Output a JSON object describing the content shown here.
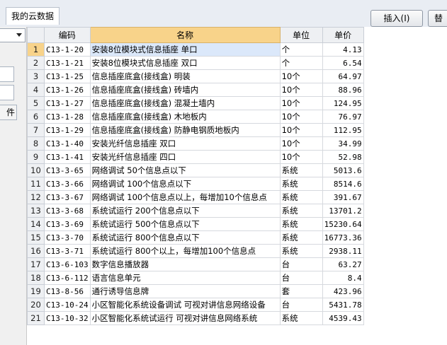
{
  "tabs": {
    "mycloud": "我的云数据"
  },
  "toolbar": {
    "insert_label": "插入(I)",
    "replace_label": "替"
  },
  "left": {
    "file_label": "件"
  },
  "grid": {
    "columns": [
      "编码",
      "名称",
      "单位",
      "单价"
    ],
    "rows": [
      {
        "n": "1",
        "code": "C13-1-20",
        "name": "安装8位模块式信息插座 单口",
        "unit": "个",
        "price": "4.13"
      },
      {
        "n": "2",
        "code": "C13-1-21",
        "name": "安装8位模块式信息插座 双口",
        "unit": "个",
        "price": "6.54"
      },
      {
        "n": "3",
        "code": "C13-1-25",
        "name": "信息插座底盒(接线盒) 明装",
        "unit": "10个",
        "price": "64.97"
      },
      {
        "n": "4",
        "code": "C13-1-26",
        "name": "信息插座底盒(接线盒) 砖墙内",
        "unit": "10个",
        "price": "88.96"
      },
      {
        "n": "5",
        "code": "C13-1-27",
        "name": "信息插座底盒(接线盒) 混凝土墙内",
        "unit": "10个",
        "price": "124.95"
      },
      {
        "n": "6",
        "code": "C13-1-28",
        "name": "信息插座底盒(接线盒) 木地板内",
        "unit": "10个",
        "price": "76.97"
      },
      {
        "n": "7",
        "code": "C13-1-29",
        "name": "信息插座底盒(接线盒) 防静电钢质地板内",
        "unit": "10个",
        "price": "112.95"
      },
      {
        "n": "8",
        "code": "C13-1-40",
        "name": "安装光纤信息插座 双口",
        "unit": "10个",
        "price": "34.99"
      },
      {
        "n": "9",
        "code": "C13-1-41",
        "name": "安装光纤信息插座 四口",
        "unit": "10个",
        "price": "52.98"
      },
      {
        "n": "10",
        "code": "C13-3-65",
        "name": "网络调试 50个信息点以下",
        "unit": "系统",
        "price": "5013.6"
      },
      {
        "n": "11",
        "code": "C13-3-66",
        "name": "网络调试 100个信息点以下",
        "unit": "系统",
        "price": "8514.6"
      },
      {
        "n": "12",
        "code": "C13-3-67",
        "name": "网络调试 100个信息点以上，每增加10个信息点",
        "unit": "系统",
        "price": "391.67"
      },
      {
        "n": "13",
        "code": "C13-3-68",
        "name": "系统试运行 200个信息点以下",
        "unit": "系统",
        "price": "13701.2"
      },
      {
        "n": "14",
        "code": "C13-3-69",
        "name": "系统试运行 500个信息点以下",
        "unit": "系统",
        "price": "15230.64"
      },
      {
        "n": "15",
        "code": "C13-3-70",
        "name": "系统试运行 800个信息点以下",
        "unit": "系统",
        "price": "16773.36"
      },
      {
        "n": "16",
        "code": "C13-3-71",
        "name": "系统试运行 800个以上，每增加100个信息点",
        "unit": "系统",
        "price": "2938.11"
      },
      {
        "n": "17",
        "code": "C13-6-103",
        "name": "数字信息播放器",
        "unit": "台",
        "price": "63.27"
      },
      {
        "n": "18",
        "code": "C13-6-112",
        "name": "语言信息单元",
        "unit": "台",
        "price": "8.4"
      },
      {
        "n": "19",
        "code": "C13-8-56",
        "name": "通行诱导信息牌",
        "unit": "套",
        "price": "423.96"
      },
      {
        "n": "20",
        "code": "C13-10-24",
        "name": "小区智能化系统设备调试 可视对讲信息网络设备",
        "unit": "台",
        "price": "5431.78"
      },
      {
        "n": "21",
        "code": "C13-10-32",
        "name": "小区智能化系统试运行 可视对讲信息网络系统",
        "unit": "系统",
        "price": "4539.43"
      }
    ]
  },
  "colors": {
    "header_accent": "#f8d38a",
    "selected_cell": "#dbe8fa"
  }
}
